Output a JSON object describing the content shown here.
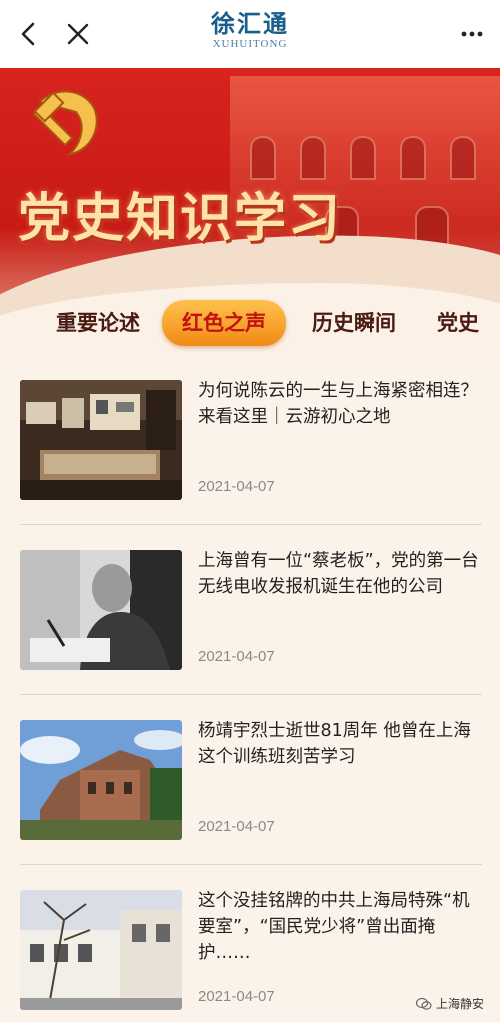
{
  "nav": {
    "back_icon": "chevron-left-icon",
    "close_icon": "close-icon",
    "more_icon": "more-dots-icon",
    "brand_cn": "徐汇通",
    "brand_en": "XUHUITONG"
  },
  "banner": {
    "title": "党史知识学习",
    "emblem_icon": "party-emblem-icon"
  },
  "tabs": [
    {
      "label": "重要论述",
      "active": false
    },
    {
      "label": "红色之声",
      "active": true
    },
    {
      "label": "历史瞬间",
      "active": false
    },
    {
      "label": "党史",
      "active": false
    }
  ],
  "articles": [
    {
      "title": "为何说陈云的一生与上海紧密相连？ 来看这里｜云游初心之地",
      "date": "2021-04-07"
    },
    {
      "title": "上海曾有一位“蔡老板”，党的第一台无线电收发报机诞生在他的公司",
      "date": "2021-04-07"
    },
    {
      "title": "杨靖宇烈士逝世81周年 他曾在上海这个训练班刻苦学习",
      "date": "2021-04-07"
    },
    {
      "title": "这个没挂铭牌的中共上海局特殊“机要室”，“国民党少将”曾出面掩护……",
      "date": "2021-04-07"
    }
  ],
  "watermark": "上海静安",
  "colors": {
    "brand_blue": "#1a5e8c",
    "banner_red": "#d8231f",
    "active_tab": "#f08a16",
    "title_gold": "#ffe2a8"
  }
}
